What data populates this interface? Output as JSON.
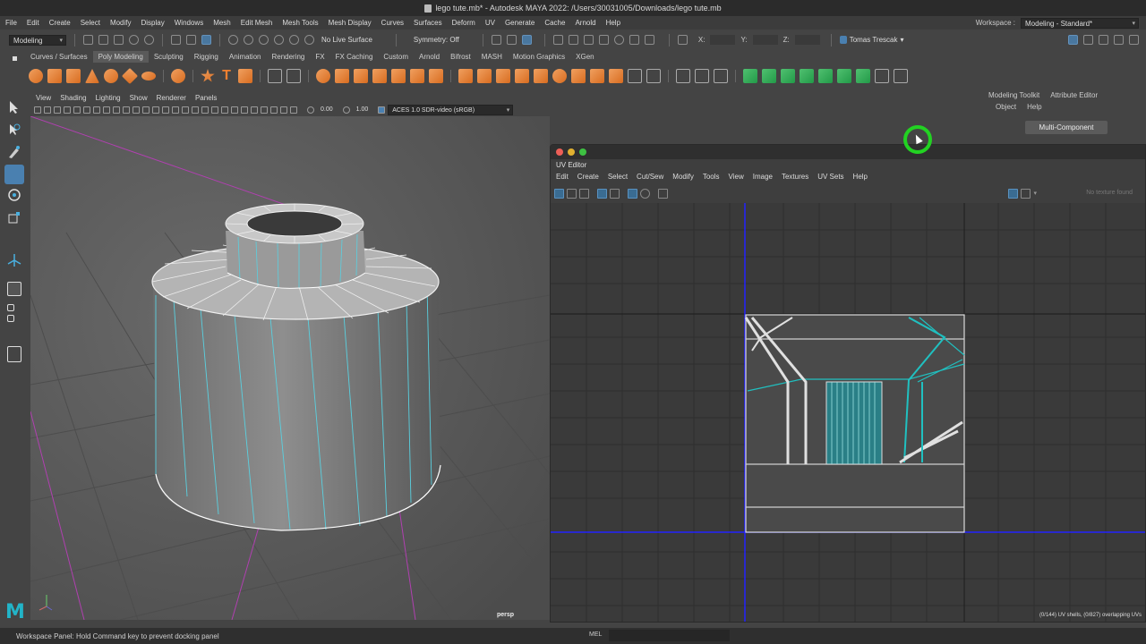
{
  "app": {
    "title": "lego tute.mb* - Autodesk MAYA 2022: /Users/30031005/Downloads/lego tute.mb"
  },
  "menubar": {
    "items": [
      "File",
      "Edit",
      "Create",
      "Select",
      "Modify",
      "Display",
      "Windows",
      "Mesh",
      "Edit Mesh",
      "Mesh Tools",
      "Mesh Display",
      "Curves",
      "Surfaces",
      "Deform",
      "UV",
      "Generate",
      "Cache",
      "Arnold",
      "Help"
    ]
  },
  "workspace": {
    "label": "Workspace :",
    "value": "Modeling - Standard*"
  },
  "statusline": {
    "mode": "Modeling",
    "live_surface": "No Live Surface",
    "symmetry": "Symmetry: Off",
    "x_label": "X:",
    "y_label": "Y:",
    "z_label": "Z:",
    "user": "Tomas Trescak"
  },
  "shelf": {
    "tabs": [
      "Curves / Surfaces",
      "Poly Modeling",
      "Sculpting",
      "Rigging",
      "Animation",
      "Rendering",
      "FX",
      "FX Caching",
      "Custom",
      "Arnold",
      "Bifrost",
      "MASH",
      "Motion Graphics",
      "XGen"
    ],
    "active_tab": "Poly Modeling",
    "text_tool_glyph": "T"
  },
  "viewport": {
    "menu": [
      "View",
      "Shading",
      "Lighting",
      "Show",
      "Renderer",
      "Panels"
    ],
    "exposure": "0.00",
    "gamma": "1.00",
    "color_space": "ACES 1.0 SDR-video (sRGB)",
    "camera_label": "persp"
  },
  "right_panel": {
    "tabs": [
      "Modeling Toolkit",
      "Attribute Editor"
    ],
    "menu": [
      "Object",
      "Help"
    ],
    "button": "Multi-Component"
  },
  "uv_editor": {
    "title": "UV Editor",
    "menu": [
      "Edit",
      "Create",
      "Select",
      "Cut/Sew",
      "Modify",
      "Tools",
      "View",
      "Image",
      "Textures",
      "UV Sets",
      "Help"
    ],
    "no_texture": "No texture found",
    "status": "(0/144) UV shells, (0/827) overlapping UVs"
  },
  "helpline": {
    "text": "Workspace Panel: Hold Command key to prevent docking panel",
    "mel_label": "MEL"
  },
  "colors": {
    "accent_teal": "#22b4c8",
    "cursor_ring": "#22d222",
    "uv_axis": "#2222ff"
  }
}
